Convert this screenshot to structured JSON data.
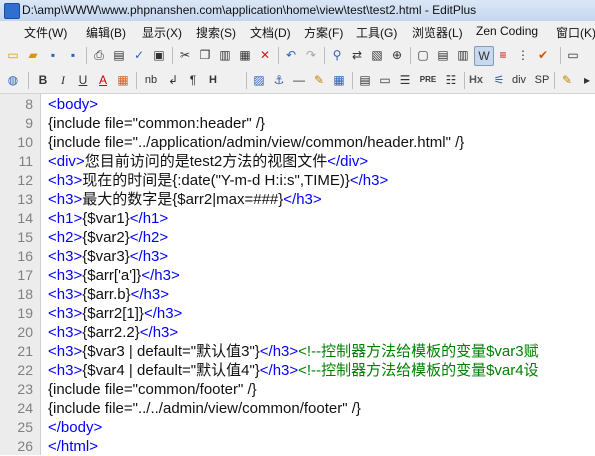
{
  "window": {
    "title": "D:\\amp\\WWW\\www.phpnanshen.com\\application\\home\\view\\test\\test2.html - EditPlus"
  },
  "menu": [
    "文件(W)",
    "编辑(B)",
    "显示(X)",
    "搜索(S)",
    "文档(D)",
    "方案(F)",
    "工具(G)",
    "浏览器(L)",
    "Zen Coding",
    "窗口(K)"
  ],
  "toolbar2_labels": {
    "hx": "Hx",
    "h": "H",
    "bold": "B",
    "italic": "I",
    "underline": "U",
    "nb": "nb",
    "para": "¶",
    "div": "div",
    "sp": "SP",
    "pre": "PRE"
  },
  "editor": {
    "lines": [
      {
        "n": "8",
        "parts": [
          {
            "t": "tag",
            "v": "<body>"
          }
        ]
      },
      {
        "n": "9",
        "parts": [
          {
            "t": "txt",
            "v": "{include file=\"common:header\" /}"
          }
        ]
      },
      {
        "n": "10",
        "parts": [
          {
            "t": "txt",
            "v": "{include file=\"../application/admin/view/common/header.html\" /}"
          }
        ]
      },
      {
        "n": "11",
        "parts": [
          {
            "t": "tag",
            "v": "<div>"
          },
          {
            "t": "txt",
            "v": "您目前访问的是test2方法的视图文件"
          },
          {
            "t": "tag",
            "v": "</div>"
          }
        ]
      },
      {
        "n": "12",
        "parts": [
          {
            "t": "tag",
            "v": "<h3>"
          },
          {
            "t": "txt",
            "v": "现在的时间是{:date(\"Y-m-d H:i:s\",TIME)}"
          },
          {
            "t": "tag",
            "v": "</h3>"
          }
        ]
      },
      {
        "n": "13",
        "parts": [
          {
            "t": "tag",
            "v": "<h3>"
          },
          {
            "t": "txt",
            "v": "最大的数字是{$arr2|max=###}"
          },
          {
            "t": "tag",
            "v": "</h3>"
          }
        ]
      },
      {
        "n": "14",
        "parts": [
          {
            "t": "tag",
            "v": "<h1>"
          },
          {
            "t": "txt",
            "v": "{$var1}"
          },
          {
            "t": "tag",
            "v": "</h1>"
          }
        ]
      },
      {
        "n": "15",
        "parts": [
          {
            "t": "tag",
            "v": "<h2>"
          },
          {
            "t": "txt",
            "v": "{$var2}"
          },
          {
            "t": "tag",
            "v": "</h2>"
          }
        ]
      },
      {
        "n": "16",
        "parts": [
          {
            "t": "tag",
            "v": "<h3>"
          },
          {
            "t": "txt",
            "v": "{$var3}"
          },
          {
            "t": "tag",
            "v": "</h3>"
          }
        ]
      },
      {
        "n": "17",
        "parts": [
          {
            "t": "tag",
            "v": "<h3>"
          },
          {
            "t": "txt",
            "v": "{$arr['a']}"
          },
          {
            "t": "tag",
            "v": "</h3>"
          }
        ]
      },
      {
        "n": "18",
        "parts": [
          {
            "t": "tag",
            "v": "<h3>"
          },
          {
            "t": "txt",
            "v": "{$arr.b}"
          },
          {
            "t": "tag",
            "v": "</h3>"
          }
        ]
      },
      {
        "n": "19",
        "parts": [
          {
            "t": "tag",
            "v": "<h3>"
          },
          {
            "t": "txt",
            "v": "{$arr2[1]}"
          },
          {
            "t": "tag",
            "v": "</h3>"
          }
        ]
      },
      {
        "n": "20",
        "parts": [
          {
            "t": "tag",
            "v": "<h3>"
          },
          {
            "t": "txt",
            "v": "{$arr2.2}"
          },
          {
            "t": "tag",
            "v": "</h3>"
          }
        ]
      },
      {
        "n": "21",
        "parts": [
          {
            "t": "tag",
            "v": "<h3>"
          },
          {
            "t": "txt",
            "v": "{$var3 | default=\"默认值3\"}"
          },
          {
            "t": "tag",
            "v": "</h3>"
          },
          {
            "t": "cmt",
            "v": "<!--控制器方法给模板的变量$var3赋"
          }
        ]
      },
      {
        "n": "22",
        "parts": [
          {
            "t": "tag",
            "v": "<h3>"
          },
          {
            "t": "txt",
            "v": "{$var4 | default=\"默认值4\"}"
          },
          {
            "t": "tag",
            "v": "</h3>"
          },
          {
            "t": "cmt",
            "v": "<!--控制器方法给模板的变量$var4设"
          }
        ]
      },
      {
        "n": "23",
        "parts": [
          {
            "t": "txt",
            "v": "{include file=\"common/footer\" /}"
          }
        ]
      },
      {
        "n": "24",
        "parts": [
          {
            "t": "txt",
            "v": "{include file=\"../../admin/view/common/footer\" /}"
          }
        ]
      },
      {
        "n": "25",
        "parts": [
          {
            "t": "tag",
            "v": "</body>"
          }
        ]
      },
      {
        "n": "26",
        "parts": [
          {
            "t": "tag",
            "v": "</html>"
          }
        ]
      }
    ]
  },
  "colors": {
    "tag": "#0000ff",
    "text": "#111111",
    "comment": "#008000",
    "line_number": "#808080"
  }
}
